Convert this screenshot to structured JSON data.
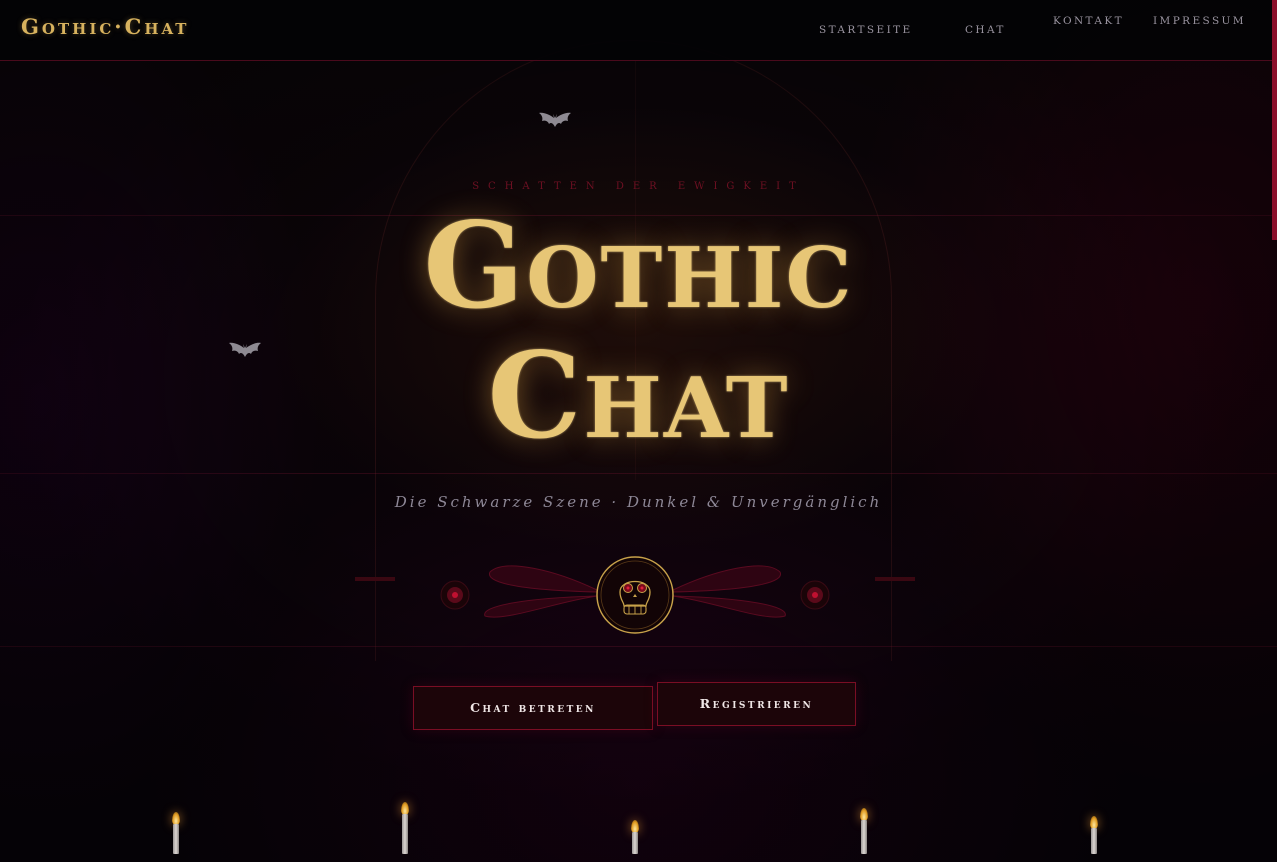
{
  "nav": {
    "logo": "Gothic·Chat",
    "links": [
      "Startseite",
      "Chat",
      "Kontakt",
      "Impressum"
    ]
  },
  "hero": {
    "eyebrow": "SCHATTEN DER EWIGKEIT",
    "title_line1": "Gothic",
    "title_line2": "Chat",
    "subtitle": "Die Schwarze Szene · Dunkel & Unvergänglich"
  },
  "buttons": {
    "enter": "Chat betreten",
    "register": "Registrieren"
  },
  "icons": {
    "bats": [
      "bat-icon",
      "bat-icon"
    ],
    "ornament_center": "skull-icon",
    "ornament_wings": "wings-ornament",
    "candles": [
      "candle-icon",
      "candle-icon",
      "candle-icon",
      "candle-icon",
      "candle-icon"
    ]
  },
  "colors": {
    "gold": "#d7b25e",
    "crimson": "#7a0e24",
    "background": "#060407",
    "muted_text": "#8d8796"
  }
}
